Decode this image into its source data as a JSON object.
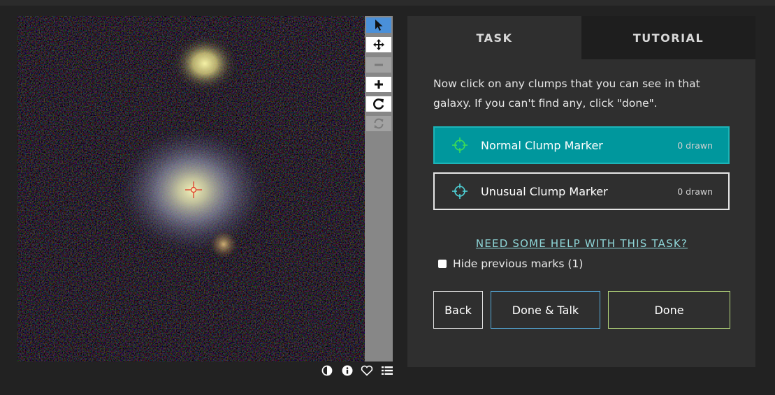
{
  "viewer": {
    "tools": [
      {
        "name": "annotate",
        "icon": "pointer-arrow-icon",
        "state": "active"
      },
      {
        "name": "pan",
        "icon": "move-arrows-icon",
        "state": "enabled"
      },
      {
        "name": "zoom-out",
        "icon": "minus-icon",
        "state": "disabled"
      },
      {
        "name": "zoom-in",
        "icon": "plus-icon",
        "state": "enabled"
      },
      {
        "name": "rotate",
        "icon": "rotate-icon",
        "state": "enabled"
      },
      {
        "name": "reset",
        "icon": "reset-icon",
        "state": "disabled"
      }
    ],
    "meta_icons": [
      "invert-contrast-icon",
      "info-icon",
      "heart-icon",
      "collection-list-icon"
    ],
    "marker_color": "#e23a2a"
  },
  "task_panel": {
    "tabs": [
      {
        "label": "TASK",
        "active": true
      },
      {
        "label": "TUTORIAL",
        "active": false
      }
    ],
    "instructions": "Now click on any clumps that you can see in that galaxy. If you can't find any, click \"done\".",
    "tool_options": [
      {
        "label": "Normal Clump Marker",
        "count": "0 drawn",
        "icon": "crosshair-icon",
        "icon_color": "#3ddc55",
        "selected": true
      },
      {
        "label": "Unusual Clump Marker",
        "count": "0 drawn",
        "icon": "crosshair-icon",
        "icon_color": "#4fd3d8",
        "selected": false
      }
    ],
    "help_link": "NEED SOME HELP WITH THIS TASK?",
    "hide_marks_label": "Hide previous marks (1)",
    "buttons": {
      "back": "Back",
      "done_talk": "Done & Talk",
      "done": "Done"
    }
  },
  "colors": {
    "page_bg": "#222222",
    "panel_bg": "#2f2f2f",
    "selected_tool": "#00979d",
    "talk_border": "#55a9d8",
    "done_border": "#b6d97c",
    "link": "#8ed6d8"
  }
}
